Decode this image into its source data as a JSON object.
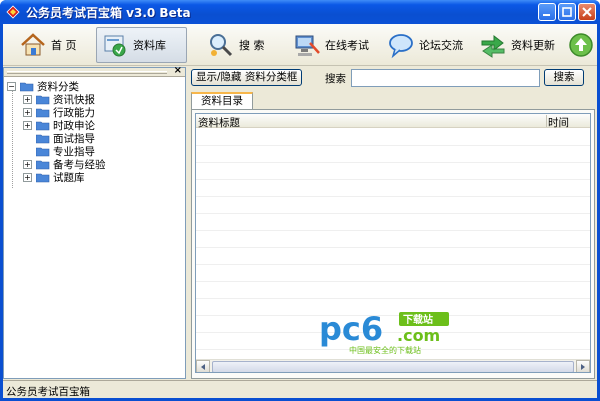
{
  "window": {
    "title": "公务员考试百宝箱 v3.0 Beta"
  },
  "toolbar": {
    "items": [
      {
        "label": "首 页",
        "icon": "home-icon"
      },
      {
        "label": "资料库",
        "icon": "library-icon"
      },
      {
        "label": "搜 索",
        "icon": "search-icon"
      },
      {
        "label": "在线考试",
        "icon": "online-exam-icon"
      },
      {
        "label": "论坛交流",
        "icon": "forum-chat-icon"
      },
      {
        "label": "资料更新",
        "icon": "update-arrows-icon"
      }
    ],
    "active_index": 1
  },
  "tree": {
    "root": "资料分类",
    "items": [
      {
        "label": "资讯快报",
        "expandable": true
      },
      {
        "label": "行政能力",
        "expandable": true
      },
      {
        "label": "时政申论",
        "expandable": true
      },
      {
        "label": "面试指导",
        "expandable": false
      },
      {
        "label": "专业指导",
        "expandable": false
      },
      {
        "label": "备考与经验",
        "expandable": true
      },
      {
        "label": "试题库",
        "expandable": true
      }
    ]
  },
  "main": {
    "toggle_button": "显示/隐藏 资料分类框",
    "search_label": "搜索",
    "search_value": "",
    "search_button": "搜索",
    "tab": "资料目录",
    "columns": [
      "资料标题",
      "时间"
    ]
  },
  "watermark": {
    "brand": "pc6",
    "brand_suffix": "下载站",
    "domain": ".com",
    "tagline": "中国最安全的下载站"
  },
  "statusbar": {
    "text": "公务员考试百宝箱"
  },
  "colors": {
    "title_bar": "#0a4fd1",
    "window_bg": "#ece9d8",
    "tab_accent": "#f7b64a",
    "watermark_blue": "#2a8ad6",
    "watermark_green": "#6cbf1a"
  }
}
